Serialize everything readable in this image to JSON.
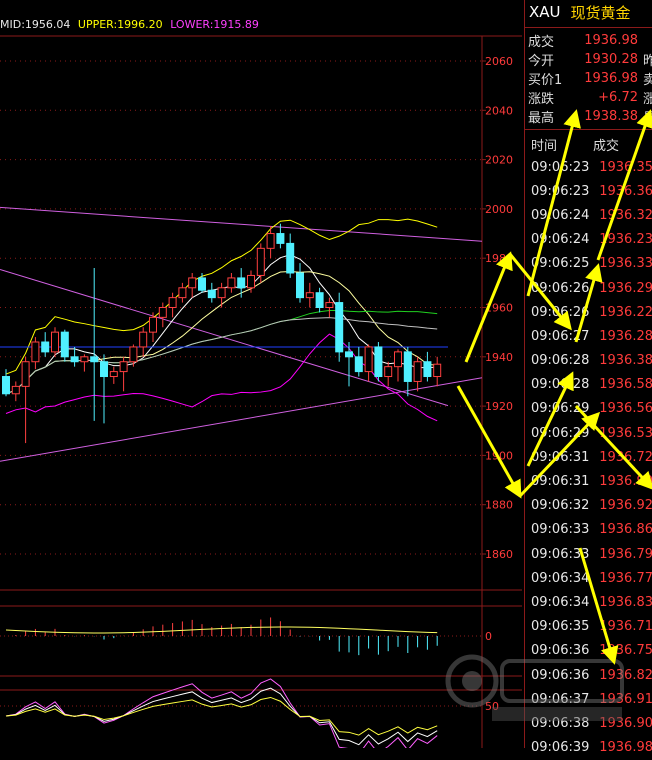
{
  "indicator": {
    "mid": "MID:1956.04",
    "upper": "UPPER:1996.20",
    "lower": "LOWER:1915.89"
  },
  "price_axis": {
    "ticks": [
      "2060",
      "2040",
      "2020",
      "2000",
      "1980",
      "1960",
      "1940",
      "1920",
      "1900",
      "1880",
      "1860"
    ]
  },
  "macd_axis": {
    "tick": "0"
  },
  "kdj_axis": {
    "tick": "50"
  },
  "quote": {
    "symbol": "XAU",
    "name": "现货黄金",
    "rows": [
      {
        "label": "成交",
        "value": "1936.98",
        "extra": ""
      },
      {
        "label": "今开",
        "value": "1930.28",
        "extra": "昨"
      },
      {
        "label": "买价1",
        "value": "1936.98",
        "extra": "卖"
      },
      {
        "label": "涨跌",
        "value": "+6.72",
        "extra": "涨"
      },
      {
        "label": "最高",
        "value": "1938.38",
        "extra": "最"
      }
    ]
  },
  "ticks_table": {
    "col_time": "时间",
    "col_price": "成交",
    "rows": [
      {
        "time": "09:06:23",
        "price": "1936.35"
      },
      {
        "time": "09:06:23",
        "price": "1936.36"
      },
      {
        "time": "09:06:24",
        "price": "1936.32"
      },
      {
        "time": "09:06:24",
        "price": "1936.23"
      },
      {
        "time": "09:06:25",
        "price": "1936.33"
      },
      {
        "time": "09:06:26",
        "price": "1936.29"
      },
      {
        "time": "09:06:26",
        "price": "1936.22"
      },
      {
        "time": "09:06:27",
        "price": "1936.28"
      },
      {
        "time": "09:06:28",
        "price": "1936.38"
      },
      {
        "time": "09:06:28",
        "price": "1936.58"
      },
      {
        "time": "09:06:29",
        "price": "1936.56"
      },
      {
        "time": "09:06:29",
        "price": "1936.53"
      },
      {
        "time": "09:06:31",
        "price": "1936.72"
      },
      {
        "time": "09:06:31",
        "price": "1936.90"
      },
      {
        "time": "09:06:32",
        "price": "1936.92"
      },
      {
        "time": "09:06:33",
        "price": "1936.86"
      },
      {
        "time": "09:06:33",
        "price": "1936.79"
      },
      {
        "time": "09:06:34",
        "price": "1936.77"
      },
      {
        "time": "09:06:34",
        "price": "1936.83"
      },
      {
        "time": "09:06:35",
        "price": "1936.71"
      },
      {
        "time": "09:06:36",
        "price": "1936.75"
      },
      {
        "time": "09:06:36",
        "price": "1936.82"
      },
      {
        "time": "09:06:37",
        "price": "1936.91"
      },
      {
        "time": "09:06:38",
        "price": "1936.90"
      },
      {
        "time": "09:06:39",
        "price": "1936.98"
      }
    ]
  },
  "candles": [
    {
      "o": 1932,
      "h": 1935,
      "l": 1924,
      "c": 1925
    },
    {
      "o": 1925,
      "h": 1930,
      "l": 1922,
      "c": 1928
    },
    {
      "o": 1928,
      "h": 1940,
      "l": 1905,
      "c": 1938
    },
    {
      "o": 1938,
      "h": 1948,
      "l": 1935,
      "c": 1946
    },
    {
      "o": 1946,
      "h": 1950,
      "l": 1940,
      "c": 1942
    },
    {
      "o": 1942,
      "h": 1952,
      "l": 1940,
      "c": 1950
    },
    {
      "o": 1950,
      "h": 1951,
      "l": 1938,
      "c": 1940
    },
    {
      "o": 1940,
      "h": 1944,
      "l": 1936,
      "c": 1938
    },
    {
      "o": 1938,
      "h": 1941,
      "l": 1934,
      "c": 1940
    },
    {
      "o": 1940,
      "h": 1976,
      "l": 1914,
      "c": 1938
    },
    {
      "o": 1938,
      "h": 1941,
      "l": 1913,
      "c": 1932
    },
    {
      "o": 1932,
      "h": 1936,
      "l": 1929,
      "c": 1934
    },
    {
      "o": 1934,
      "h": 1940,
      "l": 1926,
      "c": 1938
    },
    {
      "o": 1938,
      "h": 1945,
      "l": 1936,
      "c": 1944
    },
    {
      "o": 1944,
      "h": 1952,
      "l": 1940,
      "c": 1950
    },
    {
      "o": 1950,
      "h": 1958,
      "l": 1946,
      "c": 1956
    },
    {
      "o": 1956,
      "h": 1962,
      "l": 1952,
      "c": 1960
    },
    {
      "o": 1960,
      "h": 1966,
      "l": 1956,
      "c": 1964
    },
    {
      "o": 1964,
      "h": 1970,
      "l": 1962,
      "c": 1968
    },
    {
      "o": 1968,
      "h": 1974,
      "l": 1964,
      "c": 1972
    },
    {
      "o": 1972,
      "h": 1974,
      "l": 1966,
      "c": 1967
    },
    {
      "o": 1967,
      "h": 1970,
      "l": 1962,
      "c": 1964
    },
    {
      "o": 1964,
      "h": 1970,
      "l": 1960,
      "c": 1968
    },
    {
      "o": 1968,
      "h": 1974,
      "l": 1966,
      "c": 1972
    },
    {
      "o": 1972,
      "h": 1976,
      "l": 1964,
      "c": 1968
    },
    {
      "o": 1968,
      "h": 1975,
      "l": 1966,
      "c": 1973
    },
    {
      "o": 1973,
      "h": 1986,
      "l": 1970,
      "c": 1984
    },
    {
      "o": 1984,
      "h": 1993,
      "l": 1980,
      "c": 1990
    },
    {
      "o": 1990,
      "h": 1994,
      "l": 1984,
      "c": 1986
    },
    {
      "o": 1986,
      "h": 1990,
      "l": 1972,
      "c": 1974
    },
    {
      "o": 1974,
      "h": 1978,
      "l": 1962,
      "c": 1964
    },
    {
      "o": 1964,
      "h": 1970,
      "l": 1960,
      "c": 1966
    },
    {
      "o": 1966,
      "h": 1968,
      "l": 1958,
      "c": 1960
    },
    {
      "o": 1960,
      "h": 1964,
      "l": 1956,
      "c": 1962
    },
    {
      "o": 1962,
      "h": 1966,
      "l": 1938,
      "c": 1942
    },
    {
      "o": 1942,
      "h": 1946,
      "l": 1928,
      "c": 1940
    },
    {
      "o": 1940,
      "h": 1944,
      "l": 1932,
      "c": 1934
    },
    {
      "o": 1934,
      "h": 1945,
      "l": 1930,
      "c": 1944
    },
    {
      "o": 1944,
      "h": 1946,
      "l": 1930,
      "c": 1932
    },
    {
      "o": 1932,
      "h": 1938,
      "l": 1928,
      "c": 1936
    },
    {
      "o": 1936,
      "h": 1943,
      "l": 1930,
      "c": 1942
    },
    {
      "o": 1942,
      "h": 1944,
      "l": 1924,
      "c": 1930
    },
    {
      "o": 1930,
      "h": 1940,
      "l": 1926,
      "c": 1938
    },
    {
      "o": 1938,
      "h": 1942,
      "l": 1930,
      "c": 1932
    },
    {
      "o": 1932,
      "h": 1940,
      "l": 1928,
      "c": 1937
    }
  ],
  "colors": {
    "up": "#ff4040",
    "down": "#50f0ff",
    "grid": "#8b1a1a",
    "mid": "#2040ff",
    "upper": "#ffff00",
    "lower": "#ff00ff",
    "ma": "#ffffa0",
    "price": "#ff3b3b",
    "annotation": "#ffff00"
  }
}
